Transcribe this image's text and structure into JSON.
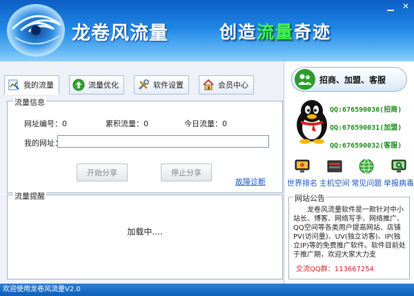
{
  "header": {
    "app_title": "龙卷风流量",
    "slogan_part1": "创造",
    "slogan_highlight": "流量",
    "slogan_part2": "奇迹"
  },
  "window_controls": {
    "minimize": "▁",
    "close": "✕"
  },
  "tabs": [
    {
      "label": "我的流量",
      "icon": "chart-icon",
      "active": true
    },
    {
      "label": "流量优化",
      "icon": "arrow-up-icon",
      "active": false
    },
    {
      "label": "软件设置",
      "icon": "tools-icon",
      "active": false
    },
    {
      "label": "会员中心",
      "icon": "home-icon",
      "active": false
    }
  ],
  "traffic_info": {
    "title": "流量信息",
    "site_id": "网址编号：0",
    "total_traffic": "累积流量：0",
    "today_traffic": "今日流量：0",
    "url_label": "我的网址：",
    "url_value": "",
    "start_button": "开始分享",
    "stop_button": "停止分享",
    "diagnose_link": "故障诊断"
  },
  "traffic_alert": {
    "title": "流量提醒",
    "loading": "加载中...."
  },
  "promo": {
    "label": "招商、加盟、客服",
    "icon": "users-icon"
  },
  "qq_contacts": [
    "QQ:676590030(招商)",
    "QQ:676590031(加盟)",
    "QQ:676590032(客服)"
  ],
  "quick_links": [
    {
      "label": "世界排名",
      "icon": "monitor-icon"
    },
    {
      "label": "主机空间",
      "icon": "server-icon"
    },
    {
      "label": "常见问题",
      "icon": "globe-icon"
    },
    {
      "label": "举报病毒",
      "icon": "shield-monitor-icon"
    }
  ],
  "notice": {
    "title": "网站公告",
    "text": "　　龙卷风流量软件是一款针对中小站长、博客、网络写手、网络推广、QQ空间等各类用户提高网站、店铺PV(访问量)、UV(独立访客)、IP(独立IP)等的免费推广软件。软件目前处于推广期，欢迎大家大力支",
    "qq_group": "交流QQ群：113667254"
  },
  "statusbar": {
    "text": "欢迎使用龙卷风流量V2.0"
  },
  "colors": {
    "header_blue": "#1f86e6",
    "slogan_green": "#3ff55a",
    "qq_green": "#1c8c1c",
    "link_blue": "#1a56c4",
    "alert_red": "#d42020"
  }
}
